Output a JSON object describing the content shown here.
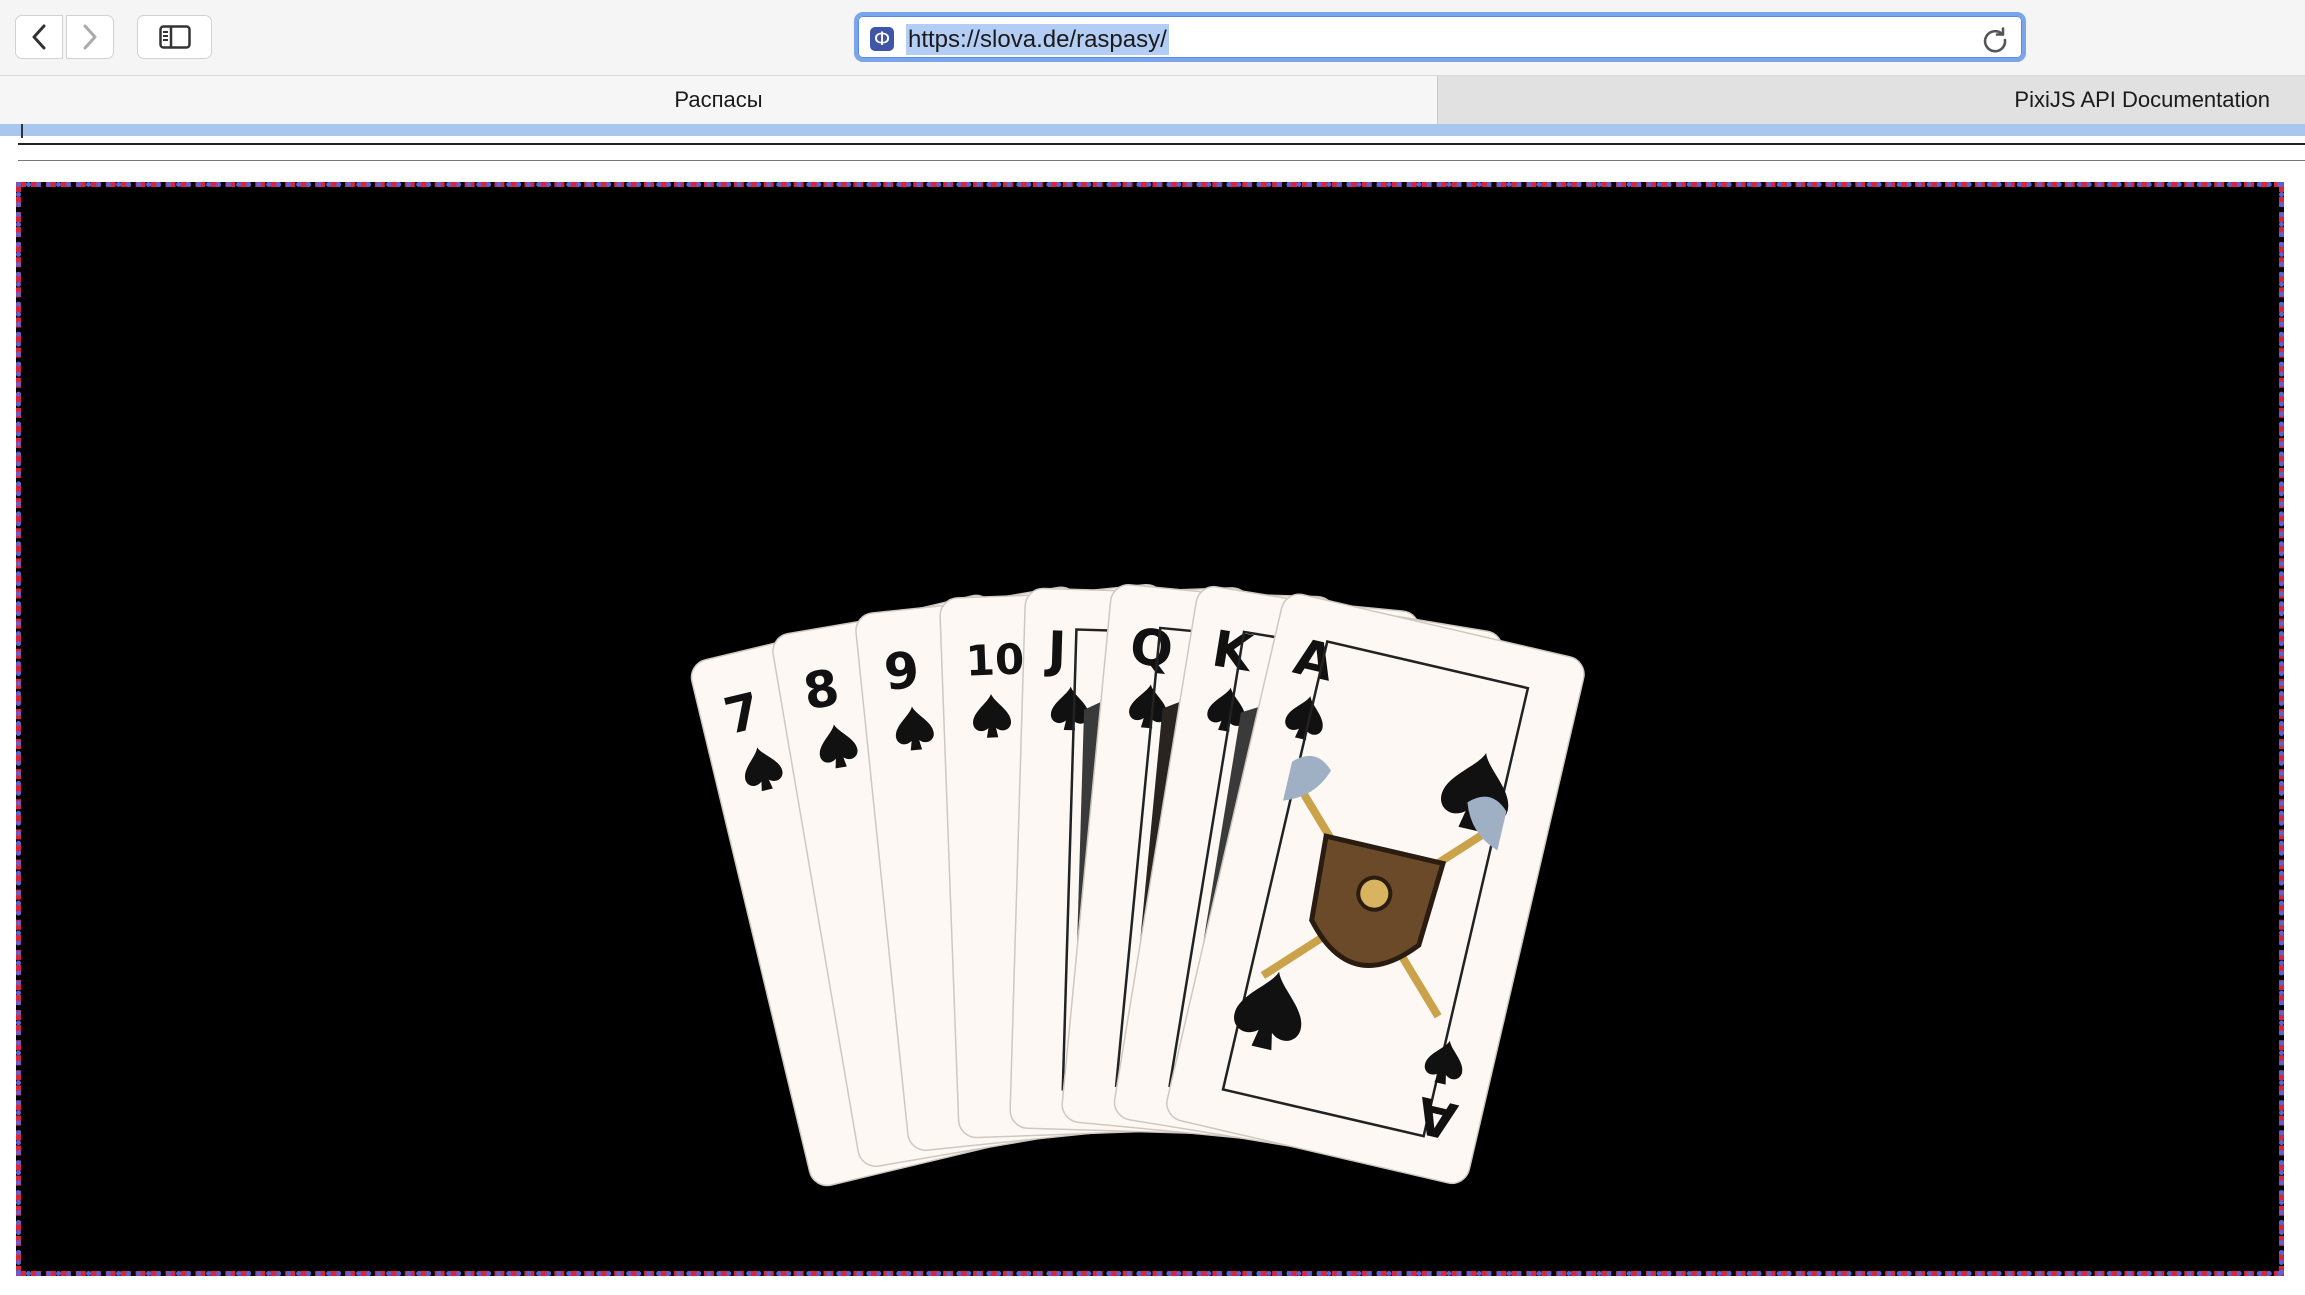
{
  "browser": {
    "url": "https://slova.de/raspasy/",
    "site_icon_glyph": "Ф",
    "accent_color": "#7aa5ec"
  },
  "tabs": [
    {
      "label": "Распасы",
      "active": true
    },
    {
      "label": "PixiJS API Documentation",
      "active": false
    }
  ],
  "game": {
    "table_color": "#000000",
    "card_color": "#fdf8f3",
    "suit": "spades",
    "cards": [
      {
        "rank": "7"
      },
      {
        "rank": "8"
      },
      {
        "rank": "9"
      },
      {
        "rank": "10"
      },
      {
        "rank": "J"
      },
      {
        "rank": "Q"
      },
      {
        "rank": "K"
      },
      {
        "rank": "A"
      }
    ]
  }
}
